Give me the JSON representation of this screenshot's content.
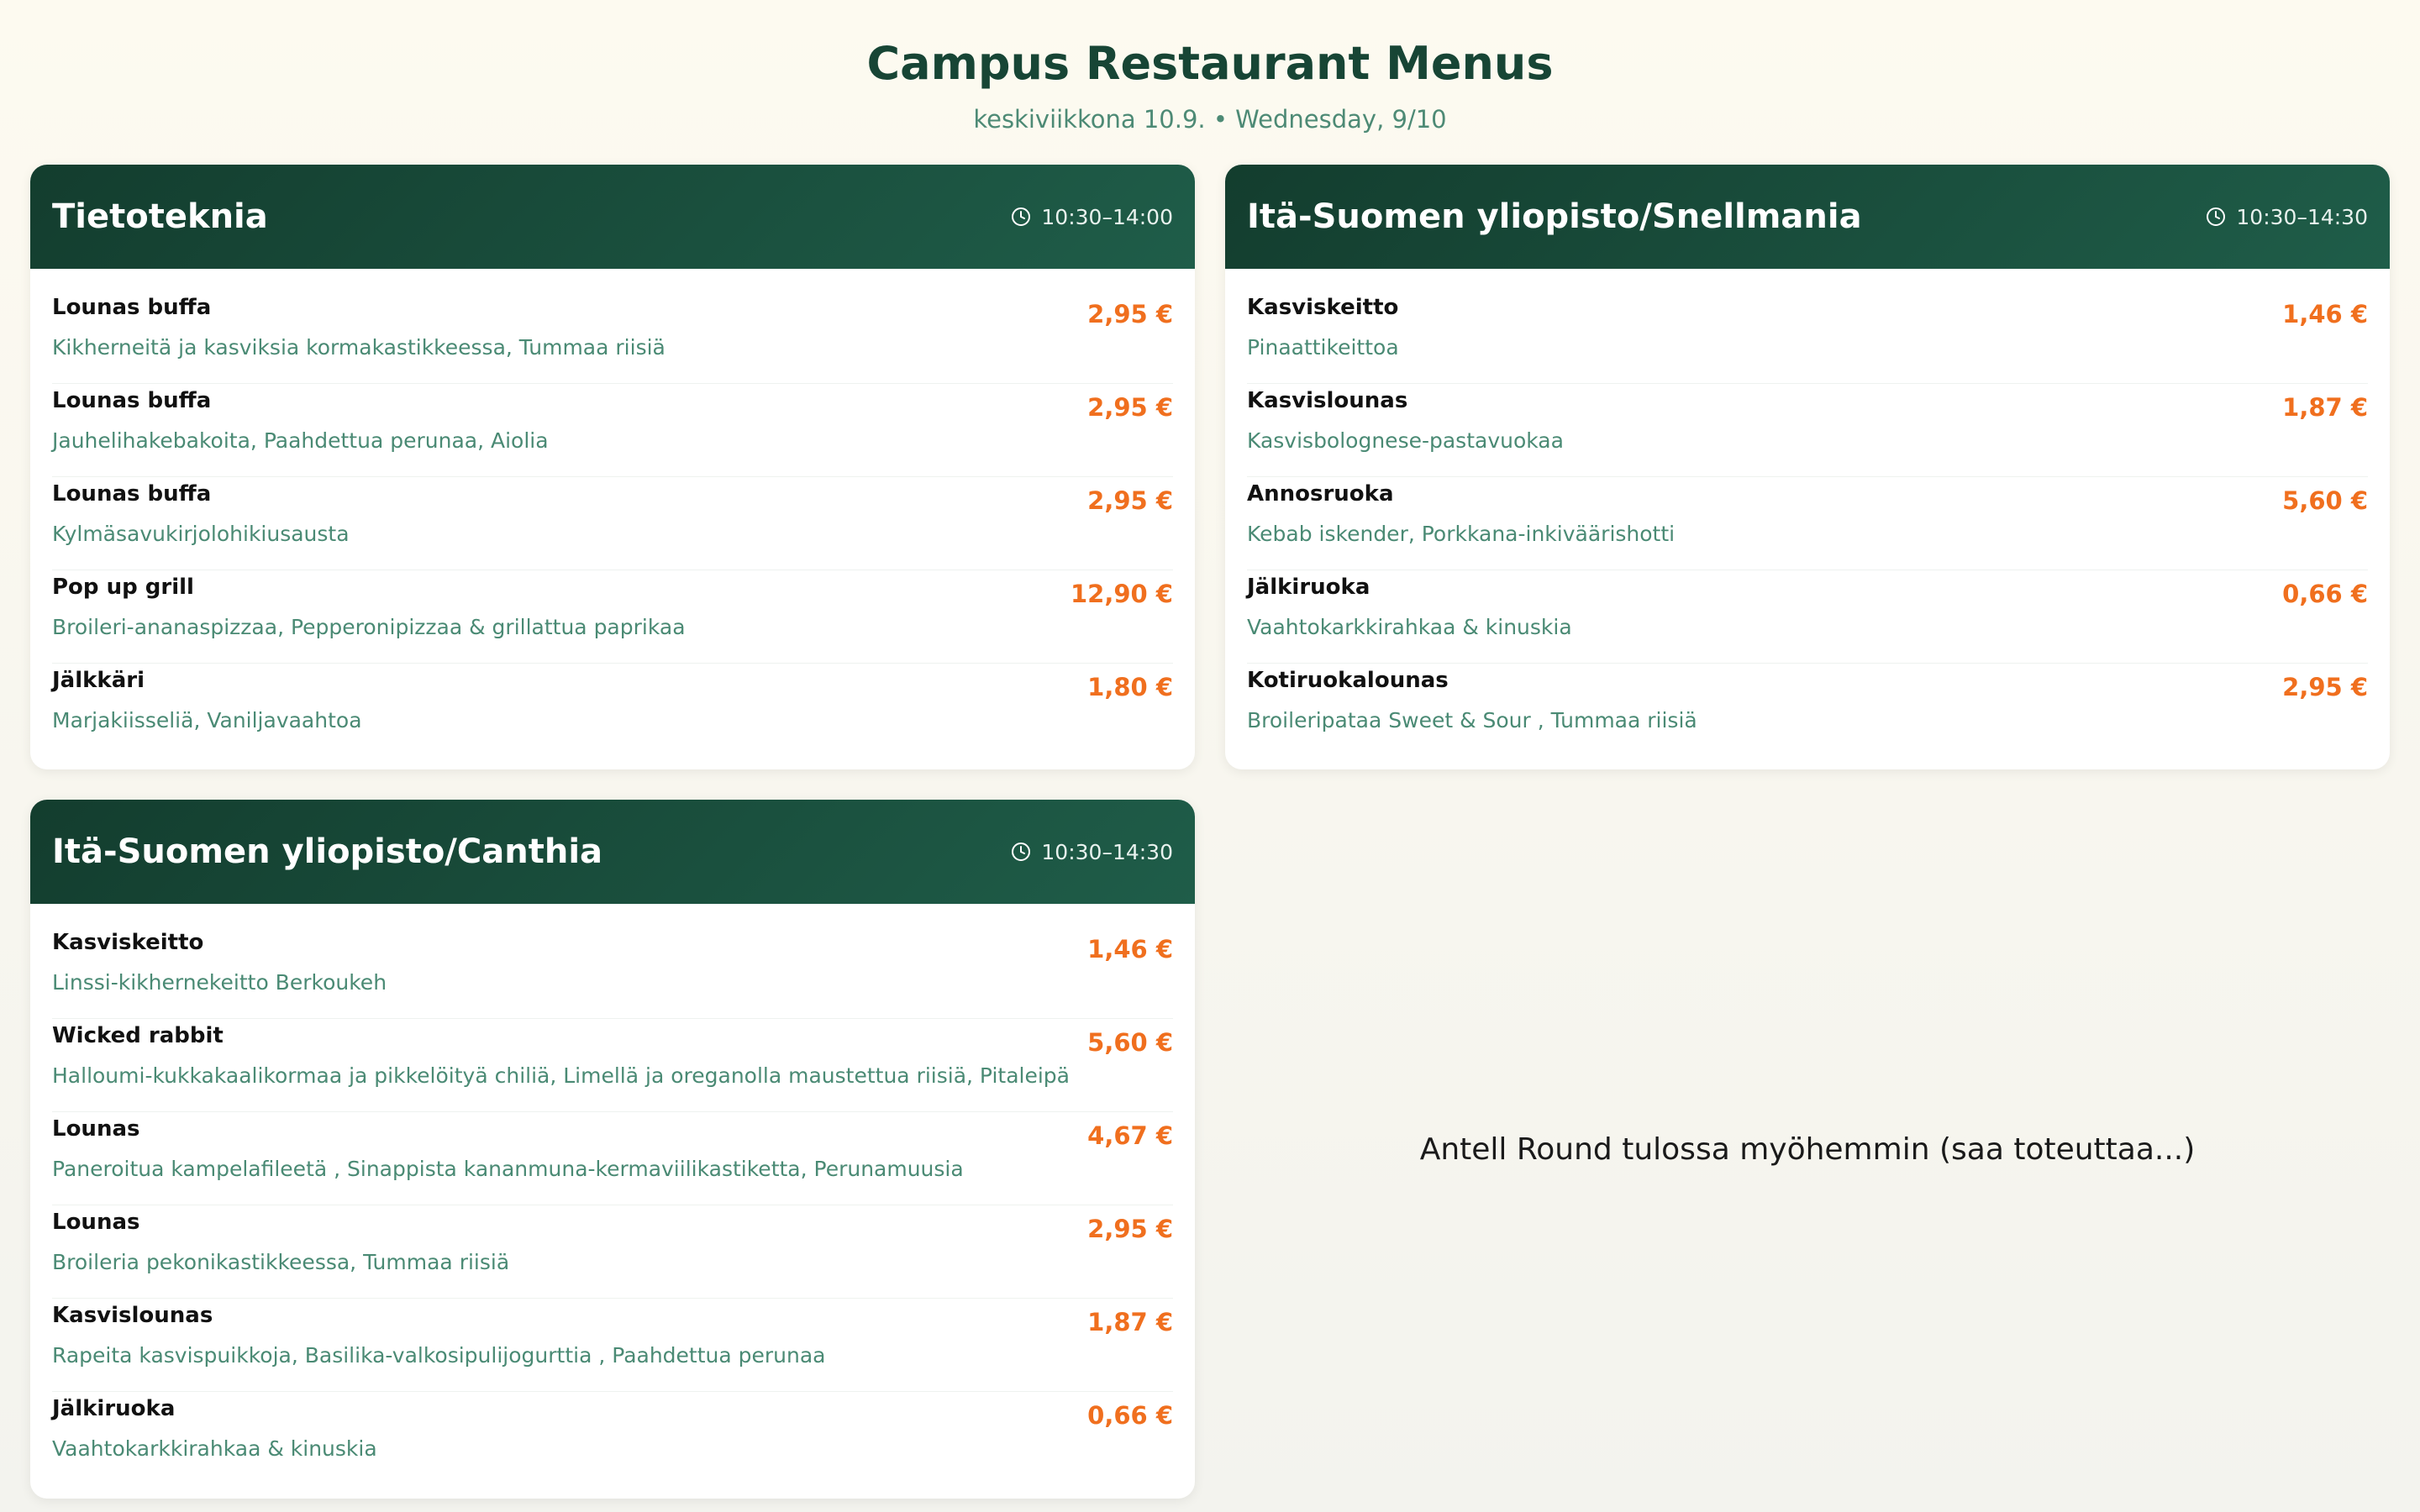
{
  "page": {
    "title": "Campus Restaurant Menus",
    "subtitle": "keskiviikkona 10.9. • Wednesday, 9/10"
  },
  "icons": {
    "hours": "clock-icon"
  },
  "colors": {
    "header_bg": "#174535",
    "price": "#f06f1e",
    "description": "#4a8a74"
  },
  "restaurants": [
    {
      "name": "Tietoteknia",
      "hours": "10:30–14:00",
      "items": [
        {
          "name": "Lounas buffa",
          "description": "Kikherneitä ja kasviksia kormakastikkeessa, Tummaa riisiä",
          "price": "2,95 €"
        },
        {
          "name": "Lounas buffa",
          "description": "Jauhelihakebakoita, Paahdettua perunaa, Aiolia",
          "price": "2,95 €"
        },
        {
          "name": "Lounas buffa",
          "description": "Kylmäsavukirjolohikiusausta",
          "price": "2,95 €"
        },
        {
          "name": "Pop up grill",
          "description": "Broileri-ananaspizzaa, Pepperonipizzaa & grillattua paprikaa",
          "price": "12,90 €"
        },
        {
          "name": "Jälkkäri",
          "description": "Marjakiisseliä, Vaniljavaahtoa",
          "price": "1,80 €"
        }
      ]
    },
    {
      "name": "Itä-Suomen yliopisto/Snellmania",
      "hours": "10:30–14:30",
      "items": [
        {
          "name": "Kasviskeitto",
          "description": "Pinaattikeittoa",
          "price": "1,46 €"
        },
        {
          "name": "Kasvislounas",
          "description": "Kasvisbolognese-pastavuokaa",
          "price": "1,87 €"
        },
        {
          "name": "Annosruoka",
          "description": "Kebab iskender, Porkkana-inkiväärishotti",
          "price": "5,60 €"
        },
        {
          "name": "Jälkiruoka",
          "description": "Vaahtokarkkirahkaa & kinuskia",
          "price": "0,66 €"
        },
        {
          "name": "Kotiruokalounas",
          "description": "Broileripataa Sweet & Sour , Tummaa riisiä",
          "price": "2,95 €"
        }
      ]
    },
    {
      "name": "Itä-Suomen yliopisto/Canthia",
      "hours": "10:30–14:30",
      "items": [
        {
          "name": "Kasviskeitto",
          "description": "Linssi-kikhernekeitto Berkoukeh",
          "price": "1,46 €"
        },
        {
          "name": "Wicked rabbit",
          "description": "Halloumi-kukkakaalikormaa ja pikkelöityä chiliä, Limellä ja oreganolla maustettua riisiä, Pitaleipä",
          "price": "5,60 €"
        },
        {
          "name": "Lounas",
          "description": "Paneroitua kampelafileetä , Sinappista kananmuna-kermaviilikastiketta, Perunamuusia",
          "price": "4,67 €"
        },
        {
          "name": "Lounas",
          "description": "Broileria pekonikastikkeessa, Tummaa riisiä",
          "price": "2,95 €"
        },
        {
          "name": "Kasvislounas",
          "description": "Rapeita kasvispuikkoja, Basilika-valkosipulijogurttia , Paahdettua perunaa",
          "price": "1,87 €"
        },
        {
          "name": "Jälkiruoka",
          "description": "Vaahtokarkkirahkaa & kinuskia",
          "price": "0,66 €"
        }
      ]
    }
  ],
  "placeholder": {
    "text": "Antell Round tulossa myöhemmin (saa toteuttaa...)"
  }
}
